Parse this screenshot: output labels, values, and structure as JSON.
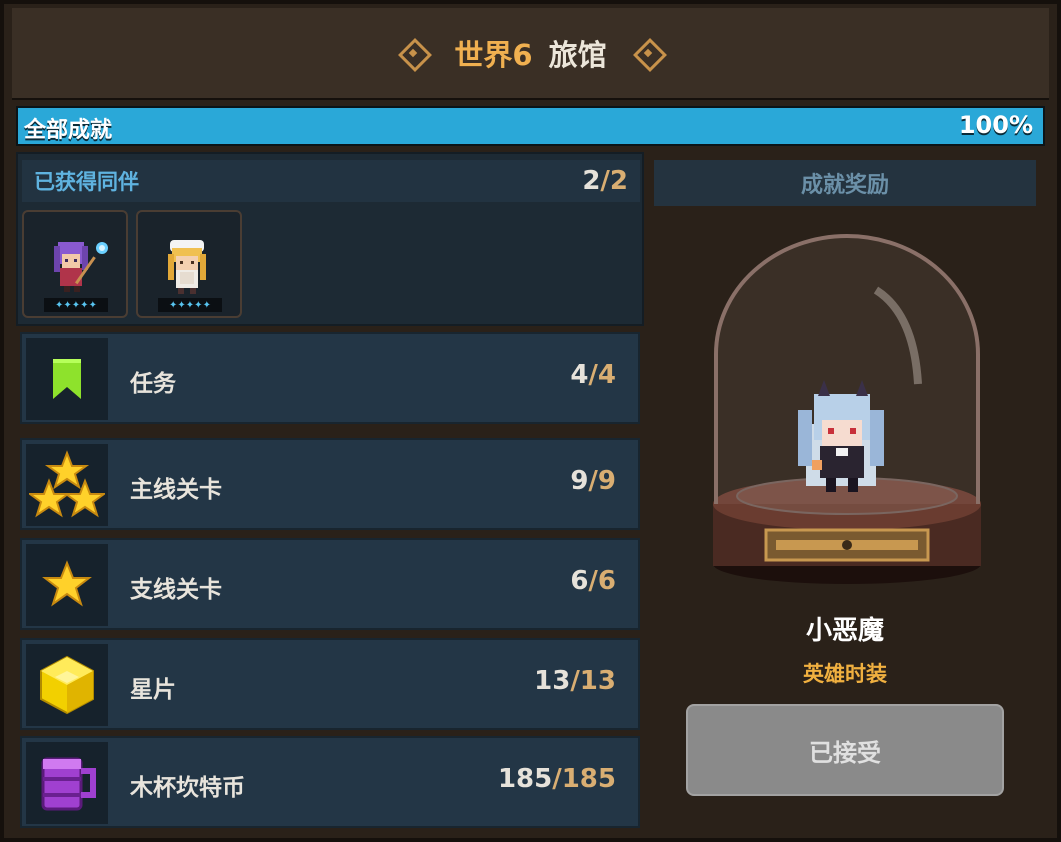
{
  "header": {
    "world": "世界6",
    "place": "旅馆"
  },
  "progress": {
    "label": "全部成就",
    "percent_text": "100%",
    "fraction": 1.0
  },
  "companions": {
    "title": "已获得同伴",
    "current": "2",
    "total": "/2",
    "slots": [
      {
        "name": "purple-haired-mage",
        "stars": "✦✦✦✦✦"
      },
      {
        "name": "blonde-maid",
        "stars": "✦✦✦✦✦"
      }
    ]
  },
  "achievements": [
    {
      "icon": "bookmark-icon",
      "label": "任务",
      "current": "4",
      "total": "/4"
    },
    {
      "icon": "three-stars-icon",
      "label": "主线关卡",
      "current": "9",
      "total": "/9"
    },
    {
      "icon": "star-icon",
      "label": "支线关卡",
      "current": "6",
      "total": "/6"
    },
    {
      "icon": "star-piece-cube-icon",
      "label": "星片",
      "current": "13",
      "total": "/13"
    },
    {
      "icon": "wooden-mug-icon",
      "label": "木杯坎特币",
      "current": "185",
      "total": "/185"
    }
  ],
  "reward": {
    "header": "成就奖励",
    "name": "小恶魔",
    "type": "英雄时装",
    "button_label": "已接受"
  },
  "colors": {
    "accent_gold": "#f0b050",
    "progress_blue": "#2aa8d8",
    "bookmark_green": "#8ee22c",
    "star_yellow": "#ffd12a",
    "mug_purple": "#a040d0"
  }
}
